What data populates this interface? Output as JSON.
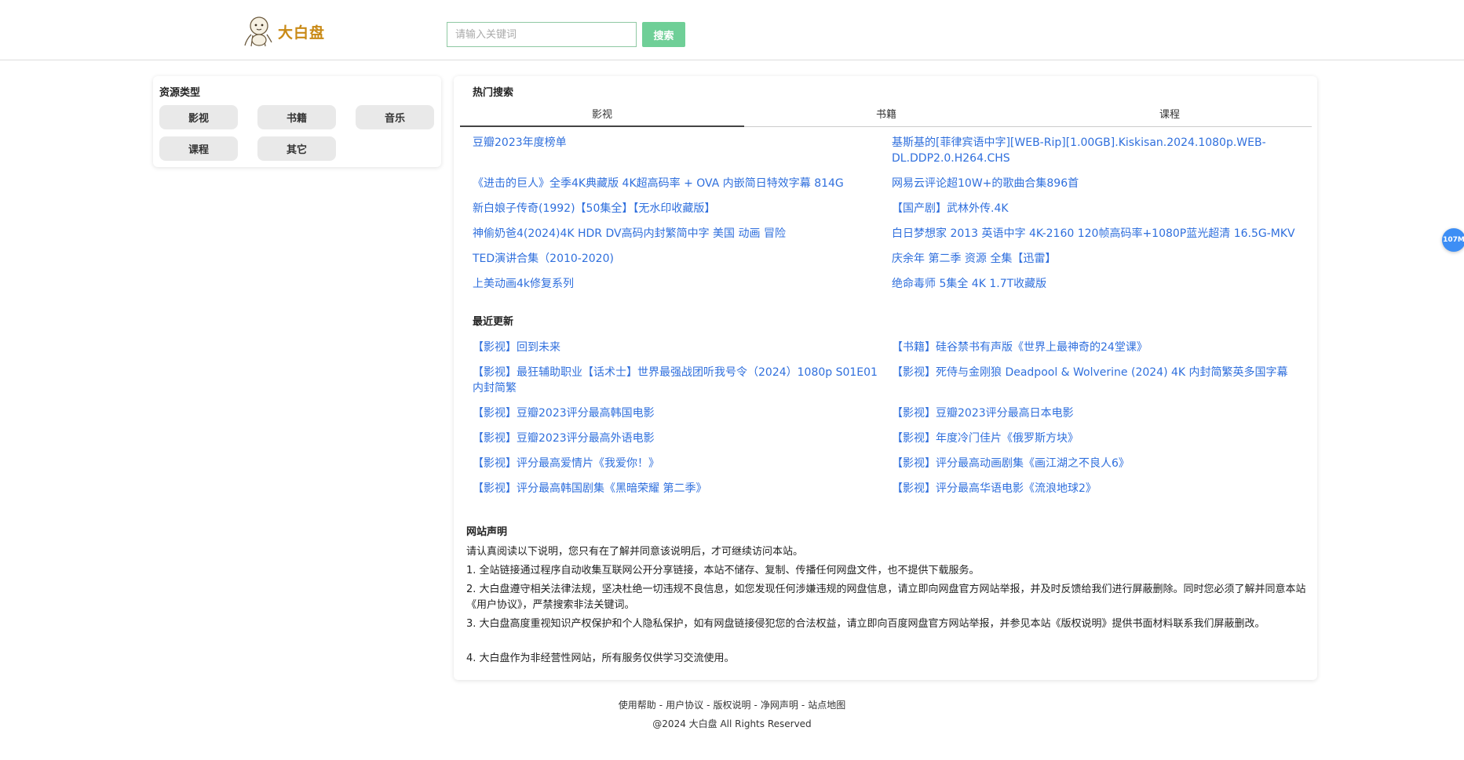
{
  "header": {
    "site_name": "大白盘",
    "search_placeholder": "请输入关键词",
    "search_button": "搜索"
  },
  "sidebar": {
    "title": "资源类型",
    "types": [
      "影视",
      "书籍",
      "音乐",
      "课程",
      "其它"
    ]
  },
  "hot": {
    "title": "热门搜索",
    "tabs": [
      "影视",
      "书籍",
      "课程"
    ],
    "active_tab": "影视",
    "left": [
      "豆瓣2023年度榜单",
      "《进击的巨人》全季4K典藏版 4K超高码率 + OVA 内嵌简日特效字幕 814G",
      "新白娘子传奇(1992)【50集全】【无水印收藏版】",
      "神偷奶爸4(2024)4K HDR DV高码内封繁简中字 美国 动画 冒险",
      "TED演讲合集（2010-2020)",
      "上美动画4k修复系列"
    ],
    "right": [
      "基斯基的[菲律宾语中字][WEB-Rip][1.00GB].Kiskisan.2024.1080p.WEB-DL.DDP2.0.H264.CHS",
      "网易云评论超10W+的歌曲合集896首",
      "【国产剧】武林外传.4K",
      "白日梦想家 2013 英语中字 4K-2160 120帧高码率+1080P蓝光超清 16.5G-MKV",
      "庆余年 第二季 资源 全集【迅雷】",
      "绝命毒师 5集全 4K 1.7T收藏版"
    ]
  },
  "recent": {
    "title": "最近更新",
    "left": [
      "【影视】回到未来",
      "【影视】最狂辅助职业【话术士】世界最强战团听我号令（2024）1080p S01E01 内封简繁",
      "【影视】豆瓣2023评分最高韩国电影",
      "【影视】豆瓣2023评分最高外语电影",
      "【影视】评分最高爱情片《我爱你！》",
      "【影视】评分最高韩国剧集《黑暗荣耀 第二季》"
    ],
    "right": [
      "【书籍】硅谷禁书有声版《世界上最神奇的24堂课》",
      "【影视】死侍与金刚狼 Deadpool & Wolverine (2024) 4K 内封简繁英多国字幕",
      "【影视】豆瓣2023评分最高日本电影",
      "【影视】年度冷门佳片《俄罗斯方块》",
      "【影视】评分最高动画剧集《画江湖之不良人6》",
      "【影视】评分最高华语电影《流浪地球2》"
    ]
  },
  "notice": {
    "title": "网站声明",
    "lines": [
      "请认真阅读以下说明，您只有在了解并同意该说明后，才可继续访问本站。",
      "1. 全站链接通过程序自动收集互联网公开分享链接，本站不储存、复制、传播任何网盘文件，也不提供下载服务。",
      "2. 大白盘遵守相关法律法规，坚决杜绝一切违规不良信息，如您发现任何涉嫌违规的网盘信息，请立即向网盘官方网站举报，并及时反馈给我们进行屏蔽删除。同时您必须了解并同意本站《用户协议》，严禁搜索非法关键词。",
      "3. 大白盘高度重视知识产权保护和个人隐私保护，如有网盘链接侵犯您的合法权益，请立即向百度网盘官方网站举报，并参见本站《版权说明》提供书面材料联系我们屏蔽删改。",
      "4. 大白盘作为非经营性网站，所有服务仅供学习交流使用。"
    ]
  },
  "footer": {
    "links": [
      "使用帮助",
      "用户协议",
      "版权说明",
      "净网声明",
      "站点地图"
    ],
    "separator": "-",
    "copyright": "@2024 大白盘 All Rights Reserved"
  },
  "float_badge": "107M"
}
